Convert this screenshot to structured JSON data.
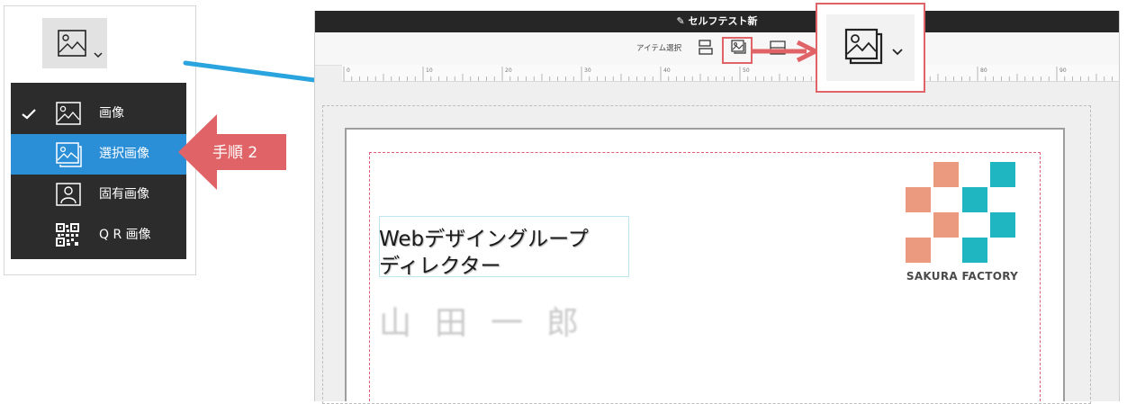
{
  "menu": {
    "items": [
      {
        "label": "画像",
        "icon": "image-icon",
        "checked": true
      },
      {
        "label": "選択画像",
        "icon": "stacked-images-icon",
        "selected": true
      },
      {
        "label": "固有画像",
        "icon": "person-image-icon"
      },
      {
        "label": "Q R 画像",
        "icon": "qr-code-icon"
      }
    ]
  },
  "step": {
    "label": "手順 2"
  },
  "editor": {
    "title": "セルフテスト新",
    "toolbar": {
      "item_select_label": "アイテム選択"
    },
    "ruler": {
      "ticks": [
        "0",
        "10",
        "20",
        "30",
        "40",
        "50",
        "60",
        "70",
        "80",
        "90"
      ]
    },
    "card": {
      "job_title_line1": "Webデザイングループ",
      "job_title_line2": "ディレクター",
      "name": "山田一郎",
      "logo_text": "SAKURA FACTORY"
    }
  },
  "colors": {
    "highlight": "#2b8fd8",
    "callout": "#e06467",
    "logo_salmon": "#ec9a7f",
    "logo_teal": "#1fb6c1",
    "blue_arrow": "#29a4de"
  }
}
